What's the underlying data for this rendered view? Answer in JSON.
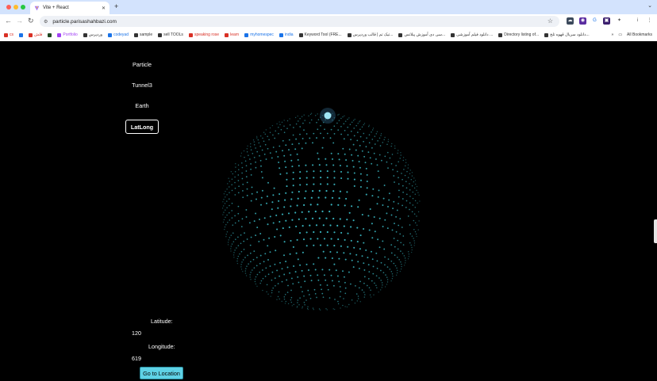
{
  "browser": {
    "tab_title": "Vite + React",
    "url": "particle.parisashahbazi.com",
    "new_tab_glyph": "+",
    "close_glyph": "✕"
  },
  "bookmarks": {
    "items": [
      {
        "label": "cs",
        "color": "#d93025"
      },
      {
        "label": "",
        "color": "#1a73e8"
      },
      {
        "label": "فلش",
        "color": "#d93025"
      },
      {
        "label": "",
        "color": "#1e4620"
      },
      {
        "label": "Portfolio",
        "color": "#a142f4"
      },
      {
        "label": "وردپرس",
        "color": "#333333"
      },
      {
        "label": "codeyad",
        "color": "#1a73e8"
      },
      {
        "label": "sample",
        "color": "#333333"
      },
      {
        "label": "sell TOOLs",
        "color": "#333333"
      },
      {
        "label": "speaking rose",
        "color": "#d93025"
      },
      {
        "label": "learn",
        "color": "#d93025"
      },
      {
        "label": "myhomespec",
        "color": "#1a73e8"
      },
      {
        "label": "india",
        "color": "#1a73e8"
      },
      {
        "label": "Keyword Tool (FRE...",
        "color": "#333333"
      },
      {
        "label": "تیک تم | قالب وردپرس...",
        "color": "#333333"
      },
      {
        "label": "سی دی آموزش پیلاتس...",
        "color": "#333333"
      },
      {
        "label": "دانلود فیلم آموزشی ...",
        "color": "#333333"
      },
      {
        "label": "Directory listing of...",
        "color": "#333333"
      },
      {
        "label": "دانلود سریال قهوه تلخ...",
        "color": "#333333"
      }
    ],
    "all_bookmarks_label": "All Bookmarks"
  },
  "app": {
    "menu": [
      {
        "label": "Particle",
        "active": false
      },
      {
        "label": "Tunnel3",
        "active": false
      },
      {
        "label": "Earth",
        "active": false
      },
      {
        "label": "LatLong",
        "active": true
      }
    ],
    "latitude_label": "Latitude:",
    "latitude_value": "120",
    "longitude_label": "Longitude:",
    "longitude_value": "619",
    "go_button": "Go to Location",
    "accent": "#5fd2e6",
    "dot_color": "#3fc8d4"
  }
}
